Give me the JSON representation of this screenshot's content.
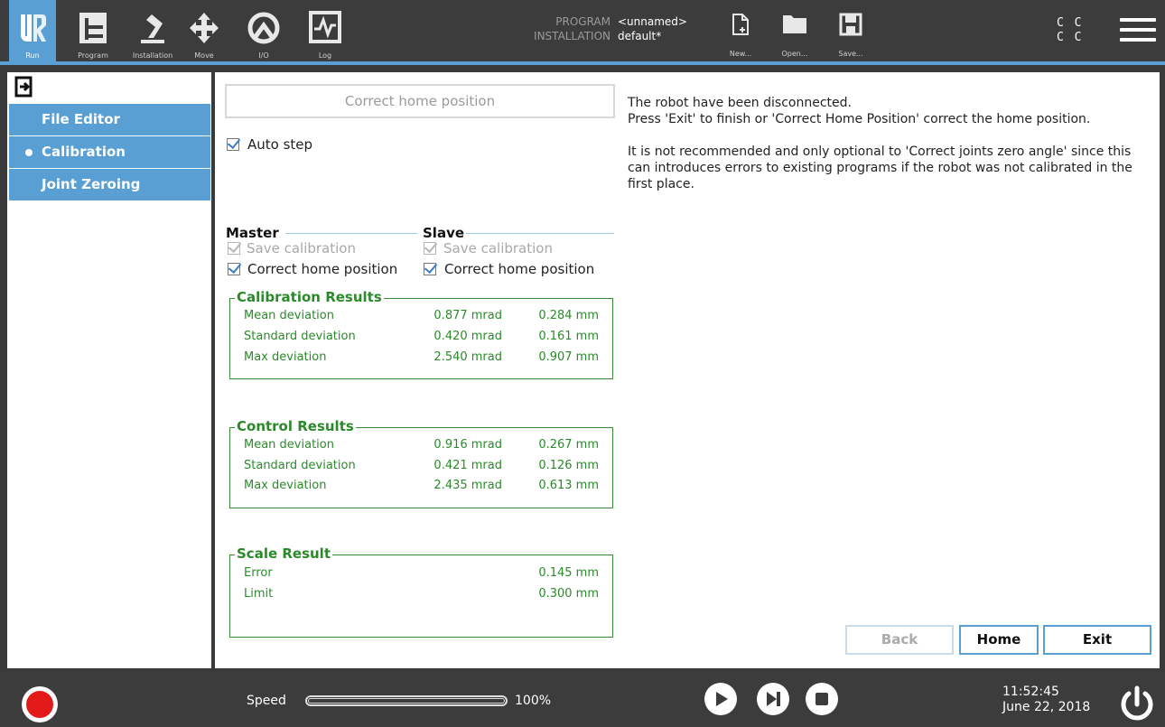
{
  "topbar": {
    "nav": [
      {
        "label": "Run",
        "icon": "ur-logo-icon"
      },
      {
        "label": "Program",
        "icon": "program-icon"
      },
      {
        "label": "Installation",
        "icon": "installation-icon"
      },
      {
        "label": "Move",
        "icon": "move-icon"
      },
      {
        "label": "I/O",
        "icon": "io-icon"
      },
      {
        "label": "Log",
        "icon": "log-icon"
      }
    ],
    "program_label": "PROGRAM",
    "program_value": "<unnamed>",
    "installation_label": "INSTALLATION",
    "installation_value": "default*",
    "file_buttons": [
      {
        "label": "New...",
        "icon": "new-file-icon"
      },
      {
        "label": "Open...",
        "icon": "folder-icon"
      },
      {
        "label": "Save...",
        "icon": "save-icon"
      }
    ],
    "cc_line1": "C C",
    "cc_line2": "C C",
    "accent_color": "#5a9fd4"
  },
  "sidebar": {
    "items": [
      {
        "label": "File Editor"
      },
      {
        "label": "Calibration",
        "selected": true
      },
      {
        "label": "Joint Zeroing"
      }
    ]
  },
  "main": {
    "correct_home_button": "Correct home position",
    "auto_step": "Auto step",
    "master": {
      "title": "Master",
      "save_calibration": "Save calibration",
      "correct_home_position": "Correct home position"
    },
    "slave": {
      "title": "Slave",
      "save_calibration": "Save calibration",
      "correct_home_position": "Correct home position"
    },
    "calibration_results": {
      "title": "Calibration Results",
      "rows": [
        {
          "label": "Mean deviation",
          "v1": "0.877 mrad",
          "v2": "0.284 mm"
        },
        {
          "label": "Standard deviation",
          "v1": "0.420 mrad",
          "v2": "0.161 mm"
        },
        {
          "label": "Max deviation",
          "v1": "2.540 mrad",
          "v2": "0.907 mm"
        }
      ]
    },
    "control_results": {
      "title": "Control Results",
      "rows": [
        {
          "label": "Mean deviation",
          "v1": "0.916 mrad",
          "v2": "0.267 mm"
        },
        {
          "label": "Standard deviation",
          "v1": "0.421 mrad",
          "v2": "0.126 mm"
        },
        {
          "label": "Max deviation",
          "v1": "2.435 mrad",
          "v2": "0.613 mm"
        }
      ]
    },
    "scale_result": {
      "title": "Scale Result",
      "rows": [
        {
          "label": "Error",
          "v2": "0.145 mm"
        },
        {
          "label": "Limit",
          "v2": "0.300 mm"
        }
      ]
    },
    "info": {
      "line1": "The robot have been disconnected.",
      "line2": "Press 'Exit' to finish or 'Correct Home Position' correct the home position.",
      "line3": "It is not recommended and only optional to 'Correct joints zero angle' since this can introduces errors to existing programs if the robot was not calibrated in the first place."
    },
    "buttons": {
      "back": "Back",
      "home": "Home",
      "exit": "Exit"
    }
  },
  "footer": {
    "speed_label": "Speed",
    "speed_value": "100%",
    "speed_fraction": 1.0,
    "time": "11:52:45",
    "date": "June 22, 2018",
    "record_color": "#e31a1a"
  }
}
